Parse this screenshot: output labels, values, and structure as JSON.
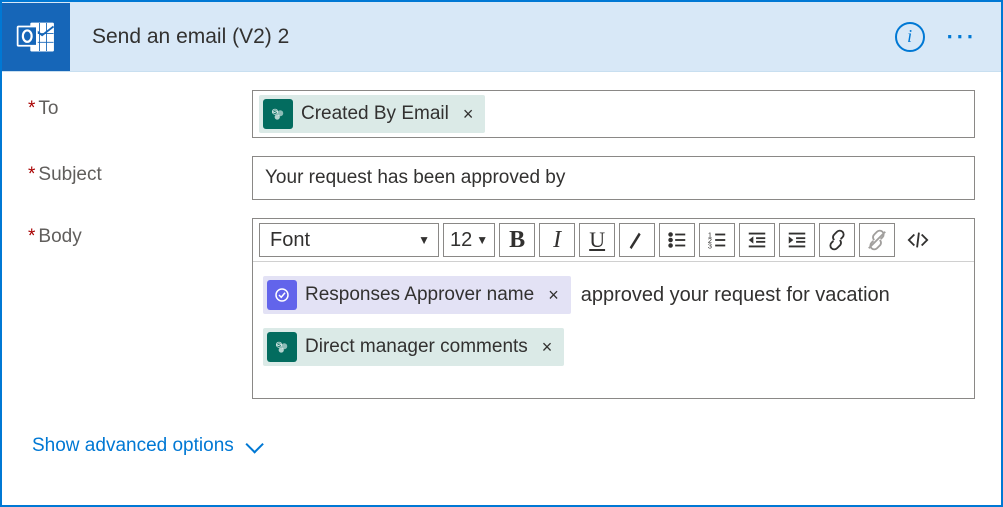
{
  "header": {
    "title": "Send an email (V2) 2"
  },
  "fields": {
    "to": {
      "label": "To",
      "tokens": [
        {
          "source": "sharepoint",
          "label": "Created By Email"
        }
      ]
    },
    "subject": {
      "label": "Subject",
      "value": "Your request has been approved by"
    },
    "body": {
      "label": "Body",
      "toolbar": {
        "font": "Font",
        "size": "12"
      },
      "content": {
        "line1_token": {
          "source": "approval",
          "label": "Responses Approver name"
        },
        "line1_text": "approved your request for vacation",
        "line2_token": {
          "source": "sharepoint",
          "label": "Direct manager comments"
        }
      }
    }
  },
  "footer": {
    "show_advanced": "Show advanced options"
  }
}
